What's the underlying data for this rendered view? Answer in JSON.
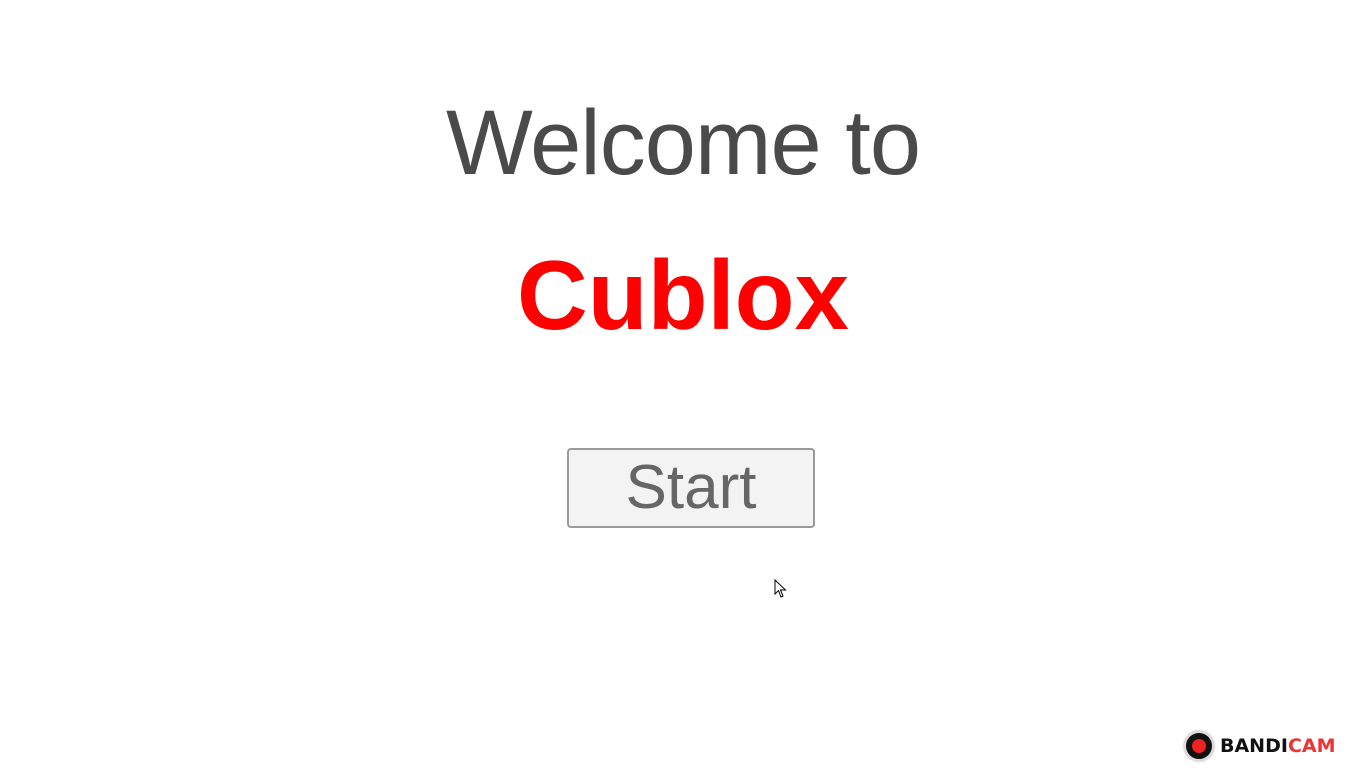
{
  "welcome_text": "Welcome to",
  "game_title": "Cublox",
  "start_button_label": "Start",
  "watermark": {
    "part1": "BANDI",
    "part2": "CAM"
  },
  "colors": {
    "title": "#ff0000",
    "watermark_accent": "#e33333"
  }
}
